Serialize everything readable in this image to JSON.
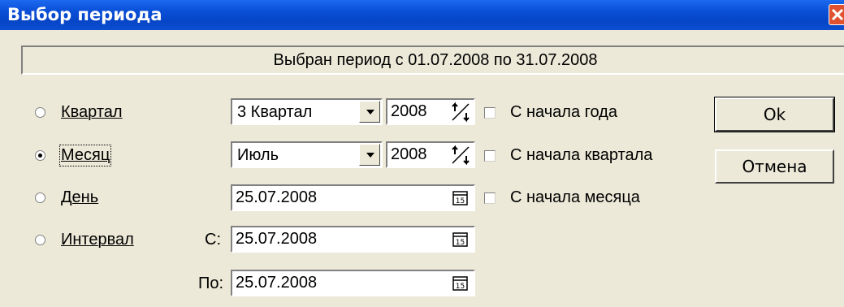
{
  "window": {
    "title": "Выбор периода"
  },
  "period_banner": "Выбран период с 01.07.2008 по 31.07.2008",
  "period_types": [
    {
      "label": "Квартал",
      "checked": false
    },
    {
      "label": "Месяц",
      "checked": true
    },
    {
      "label": "День",
      "checked": false
    },
    {
      "label": "Интервал",
      "checked": false
    }
  ],
  "quarter": {
    "value": "3 Квартал",
    "year": "2008"
  },
  "month": {
    "value": "Июль",
    "year": "2008"
  },
  "day": {
    "value": "25.07.2008"
  },
  "interval": {
    "from_label": "С:",
    "from_value": "25.07.2008",
    "to_label": "По:",
    "to_value": "25.07.2008"
  },
  "checkboxes": [
    {
      "label": "С начала года",
      "checked": false
    },
    {
      "label": "С начала квартала",
      "checked": false
    },
    {
      "label": "С начала месяца",
      "checked": false
    }
  ],
  "buttons": {
    "ok": "Ok",
    "cancel": "Отмена"
  },
  "icons": {
    "calendar": "calendar-icon",
    "spin": "spin-icon",
    "dropdown": "chevron-down-icon",
    "close": "close-icon"
  }
}
